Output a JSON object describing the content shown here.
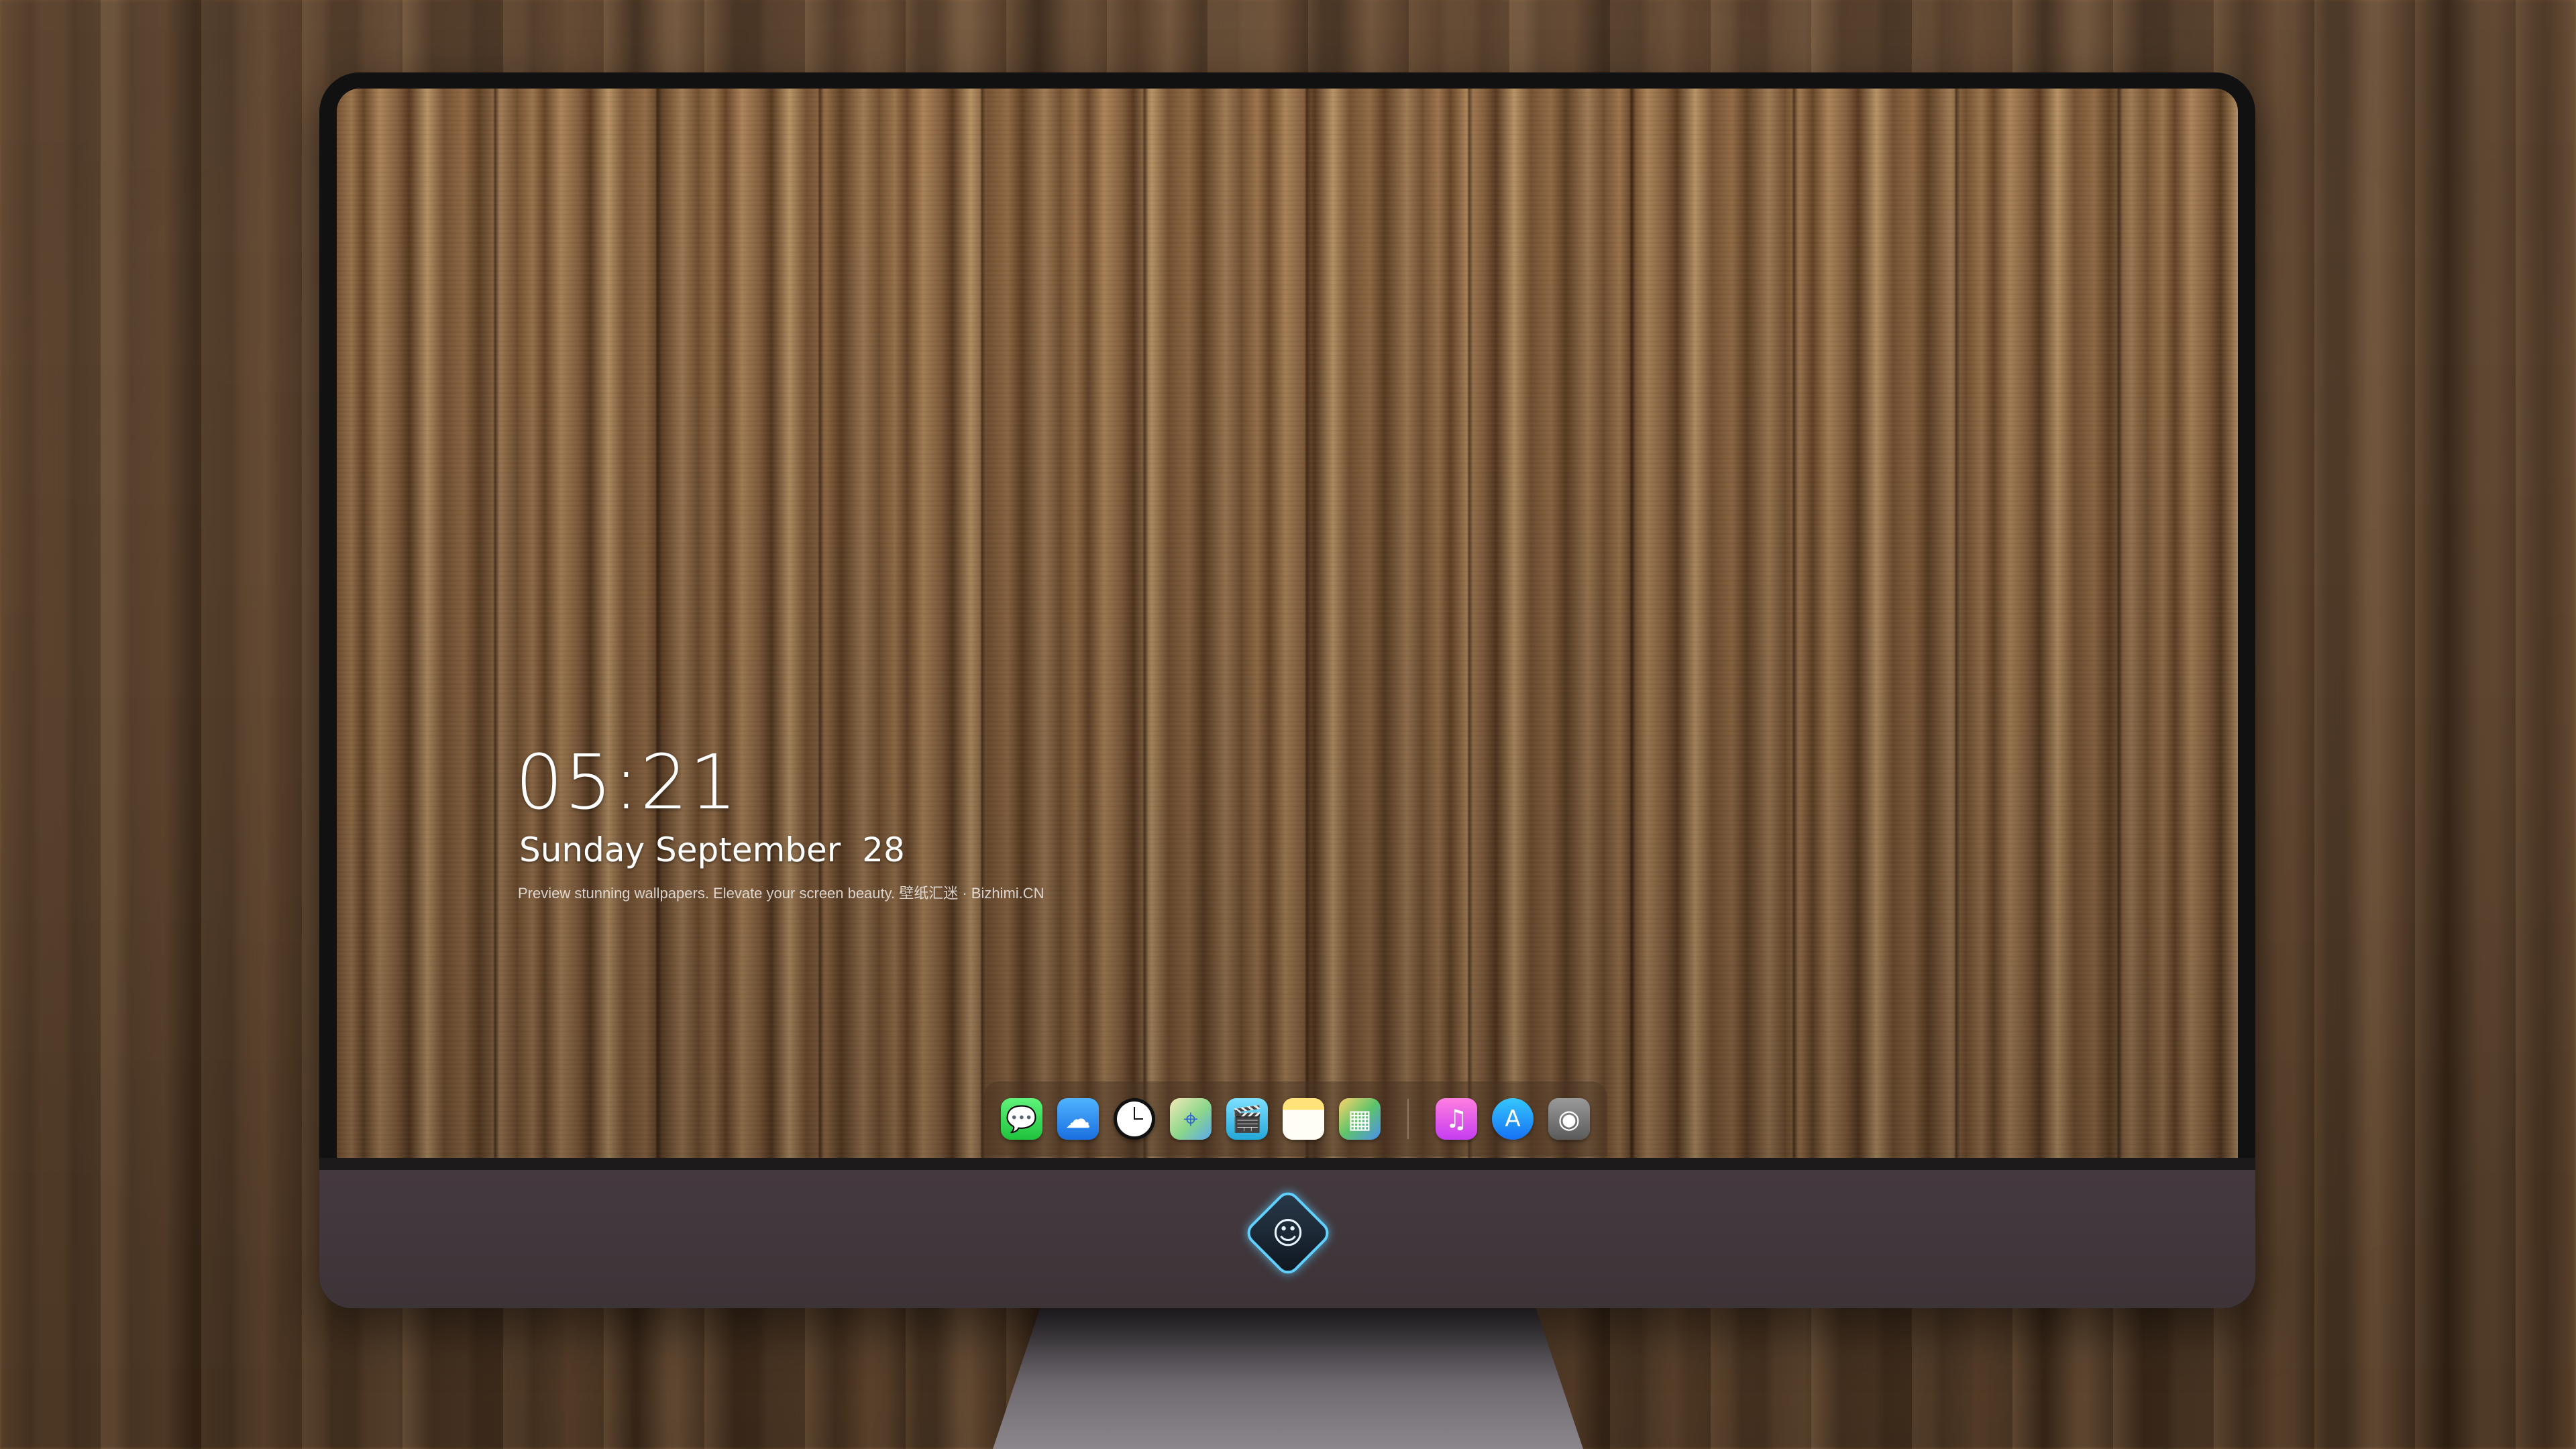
{
  "lock_screen": {
    "time": "05:21",
    "date": "Sunday September  28",
    "credit": "Preview stunning wallpapers. Elevate your screen beauty. 壁纸汇迷 · Bizhimi.CN"
  },
  "dock": {
    "apps": [
      {
        "name": "Messages",
        "icon": "messages-icon",
        "glyph": "💬"
      },
      {
        "name": "Weather",
        "icon": "weather-icon",
        "glyph": "☁"
      },
      {
        "name": "Clock",
        "icon": "clock-icon",
        "glyph": ""
      },
      {
        "name": "Maps",
        "icon": "maps-icon",
        "glyph": "⌖"
      },
      {
        "name": "Clips",
        "icon": "clips-icon",
        "glyph": "🎬"
      },
      {
        "name": "Notes",
        "icon": "notes-icon",
        "glyph": ""
      },
      {
        "name": "Photos",
        "icon": "photos-icon",
        "glyph": "▦"
      },
      {
        "name": "Music",
        "icon": "music-icon",
        "glyph": "♫"
      },
      {
        "name": "App Store",
        "icon": "app-store-icon",
        "glyph": "A"
      },
      {
        "name": "Camera",
        "icon": "camera-icon",
        "glyph": "◉"
      }
    ]
  },
  "monitor": {
    "logo_icon": "mascot-logo-icon",
    "logo_glyph": "☺"
  },
  "colors": {
    "screen_bezel": "#111111",
    "chin": "#44393f",
    "logo_glow": "#5fd0ff"
  }
}
